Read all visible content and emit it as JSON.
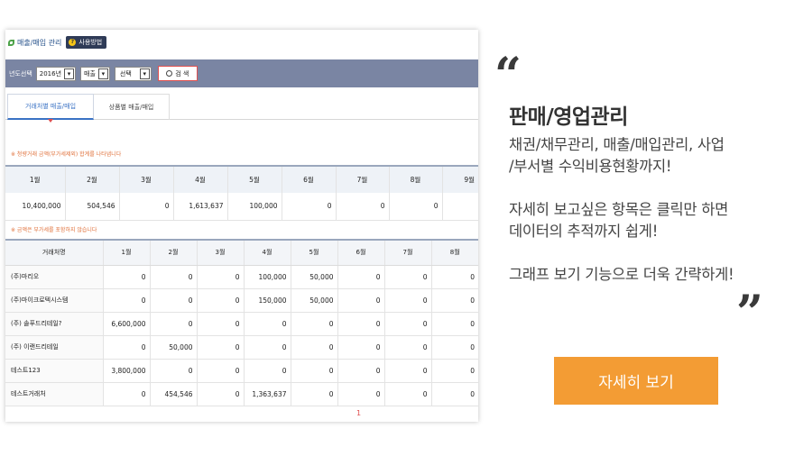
{
  "screenshot": {
    "title": "매출/매입 관리",
    "help_label": "사용방법",
    "toolbar": {
      "year_label": "년도선택",
      "year_value": "2016년",
      "type_value": "매출",
      "select_value": "선택",
      "search_label": "검 색"
    },
    "tabs": [
      "거래처별 매출/매입",
      "상품별 매출/매입"
    ],
    "note1": "※ 청량거래 금액(부가세제외) 합계를 나타냅니다",
    "note2": "※ 금액은 부가세를 포함하지 않습니다",
    "summary": {
      "headers": [
        "1월",
        "2월",
        "3월",
        "4월",
        "5월",
        "6월",
        "7월",
        "8월",
        "9월"
      ],
      "values": [
        "10,400,000",
        "504,546",
        "0",
        "1,613,637",
        "100,000",
        "0",
        "0",
        "0",
        ""
      ]
    },
    "detail": {
      "headers": [
        "거래처명",
        "1월",
        "2월",
        "3월",
        "4월",
        "5월",
        "6월",
        "7월",
        "8월"
      ],
      "rows": [
        [
          "(주)마리오",
          "0",
          "0",
          "0",
          "100,000",
          "50,000",
          "0",
          "0",
          "0"
        ],
        [
          "(주)마이크로텍시스템",
          "0",
          "0",
          "0",
          "150,000",
          "50,000",
          "0",
          "0",
          "0"
        ],
        [
          "(주) 솔푸드리테일?",
          "6,600,000",
          "0",
          "0",
          "0",
          "0",
          "0",
          "0",
          "0"
        ],
        [
          "(주) 이랜드리테일",
          "0",
          "50,000",
          "0",
          "0",
          "0",
          "0",
          "0",
          "0"
        ],
        [
          "테스트123",
          "3,800,000",
          "0",
          "0",
          "0",
          "0",
          "0",
          "0",
          "0"
        ],
        [
          "테스트거래처",
          "0",
          "454,546",
          "0",
          "1,363,637",
          "0",
          "0",
          "0",
          "0"
        ]
      ]
    },
    "page_number": "1"
  },
  "promo": {
    "open_quote": "“",
    "close_quote": "”",
    "heading": "판매/영업관리",
    "desc1": [
      "채권/채무관리, 매출/매입관리, 사업",
      "/부서별 수익비용현황까지!"
    ],
    "desc2": [
      "자세히 보고싶은 항목은 클릭만 하면",
      "데이터의 추적까지 쉽게!"
    ],
    "desc3": [
      "그래프 보기 기능으로 더욱 간략하게!"
    ],
    "button_label": "자세히 보기"
  },
  "colors": {
    "accent_orange": "#f39c34",
    "toolbar_bg": "#7a85a3",
    "tab_blue": "#3a72c4",
    "note_orange": "#e0703a"
  }
}
